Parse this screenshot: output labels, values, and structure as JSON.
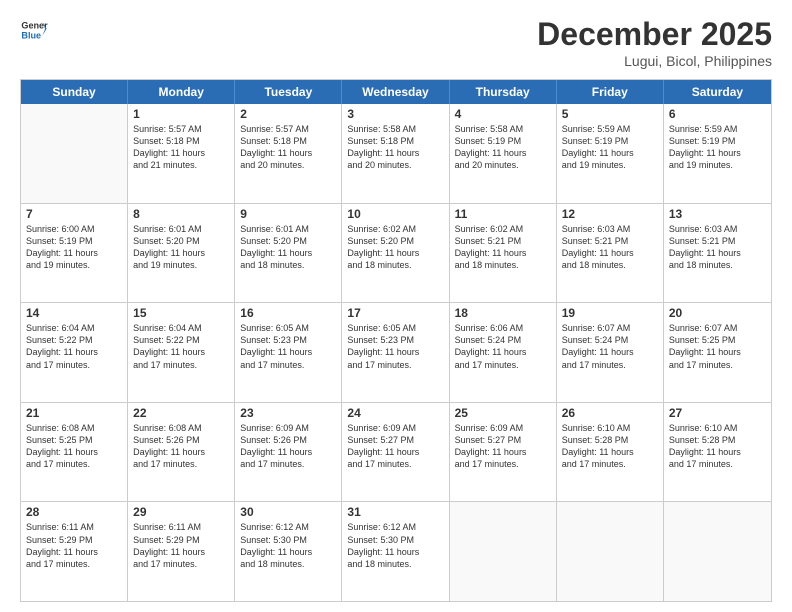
{
  "logo": {
    "line1": "General",
    "line2": "Blue"
  },
  "title": "December 2025",
  "location": "Lugui, Bicol, Philippines",
  "days": [
    "Sunday",
    "Monday",
    "Tuesday",
    "Wednesday",
    "Thursday",
    "Friday",
    "Saturday"
  ],
  "weeks": [
    [
      {
        "day": "",
        "info": ""
      },
      {
        "day": "1",
        "info": "Sunrise: 5:57 AM\nSunset: 5:18 PM\nDaylight: 11 hours\nand 21 minutes."
      },
      {
        "day": "2",
        "info": "Sunrise: 5:57 AM\nSunset: 5:18 PM\nDaylight: 11 hours\nand 20 minutes."
      },
      {
        "day": "3",
        "info": "Sunrise: 5:58 AM\nSunset: 5:18 PM\nDaylight: 11 hours\nand 20 minutes."
      },
      {
        "day": "4",
        "info": "Sunrise: 5:58 AM\nSunset: 5:19 PM\nDaylight: 11 hours\nand 20 minutes."
      },
      {
        "day": "5",
        "info": "Sunrise: 5:59 AM\nSunset: 5:19 PM\nDaylight: 11 hours\nand 19 minutes."
      },
      {
        "day": "6",
        "info": "Sunrise: 5:59 AM\nSunset: 5:19 PM\nDaylight: 11 hours\nand 19 minutes."
      }
    ],
    [
      {
        "day": "7",
        "info": "Sunrise: 6:00 AM\nSunset: 5:19 PM\nDaylight: 11 hours\nand 19 minutes."
      },
      {
        "day": "8",
        "info": "Sunrise: 6:01 AM\nSunset: 5:20 PM\nDaylight: 11 hours\nand 19 minutes."
      },
      {
        "day": "9",
        "info": "Sunrise: 6:01 AM\nSunset: 5:20 PM\nDaylight: 11 hours\nand 18 minutes."
      },
      {
        "day": "10",
        "info": "Sunrise: 6:02 AM\nSunset: 5:20 PM\nDaylight: 11 hours\nand 18 minutes."
      },
      {
        "day": "11",
        "info": "Sunrise: 6:02 AM\nSunset: 5:21 PM\nDaylight: 11 hours\nand 18 minutes."
      },
      {
        "day": "12",
        "info": "Sunrise: 6:03 AM\nSunset: 5:21 PM\nDaylight: 11 hours\nand 18 minutes."
      },
      {
        "day": "13",
        "info": "Sunrise: 6:03 AM\nSunset: 5:21 PM\nDaylight: 11 hours\nand 18 minutes."
      }
    ],
    [
      {
        "day": "14",
        "info": "Sunrise: 6:04 AM\nSunset: 5:22 PM\nDaylight: 11 hours\nand 17 minutes."
      },
      {
        "day": "15",
        "info": "Sunrise: 6:04 AM\nSunset: 5:22 PM\nDaylight: 11 hours\nand 17 minutes."
      },
      {
        "day": "16",
        "info": "Sunrise: 6:05 AM\nSunset: 5:23 PM\nDaylight: 11 hours\nand 17 minutes."
      },
      {
        "day": "17",
        "info": "Sunrise: 6:05 AM\nSunset: 5:23 PM\nDaylight: 11 hours\nand 17 minutes."
      },
      {
        "day": "18",
        "info": "Sunrise: 6:06 AM\nSunset: 5:24 PM\nDaylight: 11 hours\nand 17 minutes."
      },
      {
        "day": "19",
        "info": "Sunrise: 6:07 AM\nSunset: 5:24 PM\nDaylight: 11 hours\nand 17 minutes."
      },
      {
        "day": "20",
        "info": "Sunrise: 6:07 AM\nSunset: 5:25 PM\nDaylight: 11 hours\nand 17 minutes."
      }
    ],
    [
      {
        "day": "21",
        "info": "Sunrise: 6:08 AM\nSunset: 5:25 PM\nDaylight: 11 hours\nand 17 minutes."
      },
      {
        "day": "22",
        "info": "Sunrise: 6:08 AM\nSunset: 5:26 PM\nDaylight: 11 hours\nand 17 minutes."
      },
      {
        "day": "23",
        "info": "Sunrise: 6:09 AM\nSunset: 5:26 PM\nDaylight: 11 hours\nand 17 minutes."
      },
      {
        "day": "24",
        "info": "Sunrise: 6:09 AM\nSunset: 5:27 PM\nDaylight: 11 hours\nand 17 minutes."
      },
      {
        "day": "25",
        "info": "Sunrise: 6:09 AM\nSunset: 5:27 PM\nDaylight: 11 hours\nand 17 minutes."
      },
      {
        "day": "26",
        "info": "Sunrise: 6:10 AM\nSunset: 5:28 PM\nDaylight: 11 hours\nand 17 minutes."
      },
      {
        "day": "27",
        "info": "Sunrise: 6:10 AM\nSunset: 5:28 PM\nDaylight: 11 hours\nand 17 minutes."
      }
    ],
    [
      {
        "day": "28",
        "info": "Sunrise: 6:11 AM\nSunset: 5:29 PM\nDaylight: 11 hours\nand 17 minutes."
      },
      {
        "day": "29",
        "info": "Sunrise: 6:11 AM\nSunset: 5:29 PM\nDaylight: 11 hours\nand 17 minutes."
      },
      {
        "day": "30",
        "info": "Sunrise: 6:12 AM\nSunset: 5:30 PM\nDaylight: 11 hours\nand 18 minutes."
      },
      {
        "day": "31",
        "info": "Sunrise: 6:12 AM\nSunset: 5:30 PM\nDaylight: 11 hours\nand 18 minutes."
      },
      {
        "day": "",
        "info": ""
      },
      {
        "day": "",
        "info": ""
      },
      {
        "day": "",
        "info": ""
      }
    ]
  ]
}
